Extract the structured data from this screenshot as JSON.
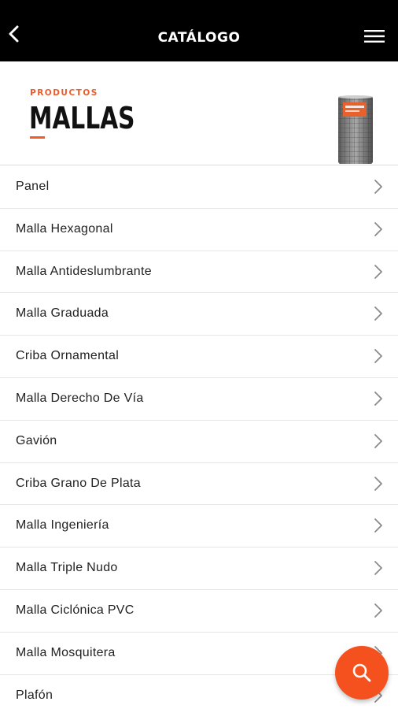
{
  "topbar": {
    "title": "CATÁLOGO",
    "back_icon": "chevron-left-icon",
    "menu_icon": "hamburger-menu-icon"
  },
  "header": {
    "kicker": "PRODUCTOS",
    "title": "MALLAS",
    "accent_color": "#f05a28"
  },
  "list": {
    "items": [
      {
        "label": "Panel"
      },
      {
        "label": "Malla Hexagonal"
      },
      {
        "label": "Malla Antideslumbrante"
      },
      {
        "label": "Malla Graduada"
      },
      {
        "label": "Criba Ornamental"
      },
      {
        "label": "Malla Derecho De Vía"
      },
      {
        "label": "Gavión"
      },
      {
        "label": "Criba Grano De Plata"
      },
      {
        "label": "Malla Ingeniería"
      },
      {
        "label": "Malla Triple Nudo"
      },
      {
        "label": "Malla Ciclónica PVC"
      },
      {
        "label": "Malla Mosquitera"
      },
      {
        "label": "Plafón"
      }
    ]
  },
  "fab": {
    "icon": "search-icon",
    "color": "#f4511e"
  }
}
